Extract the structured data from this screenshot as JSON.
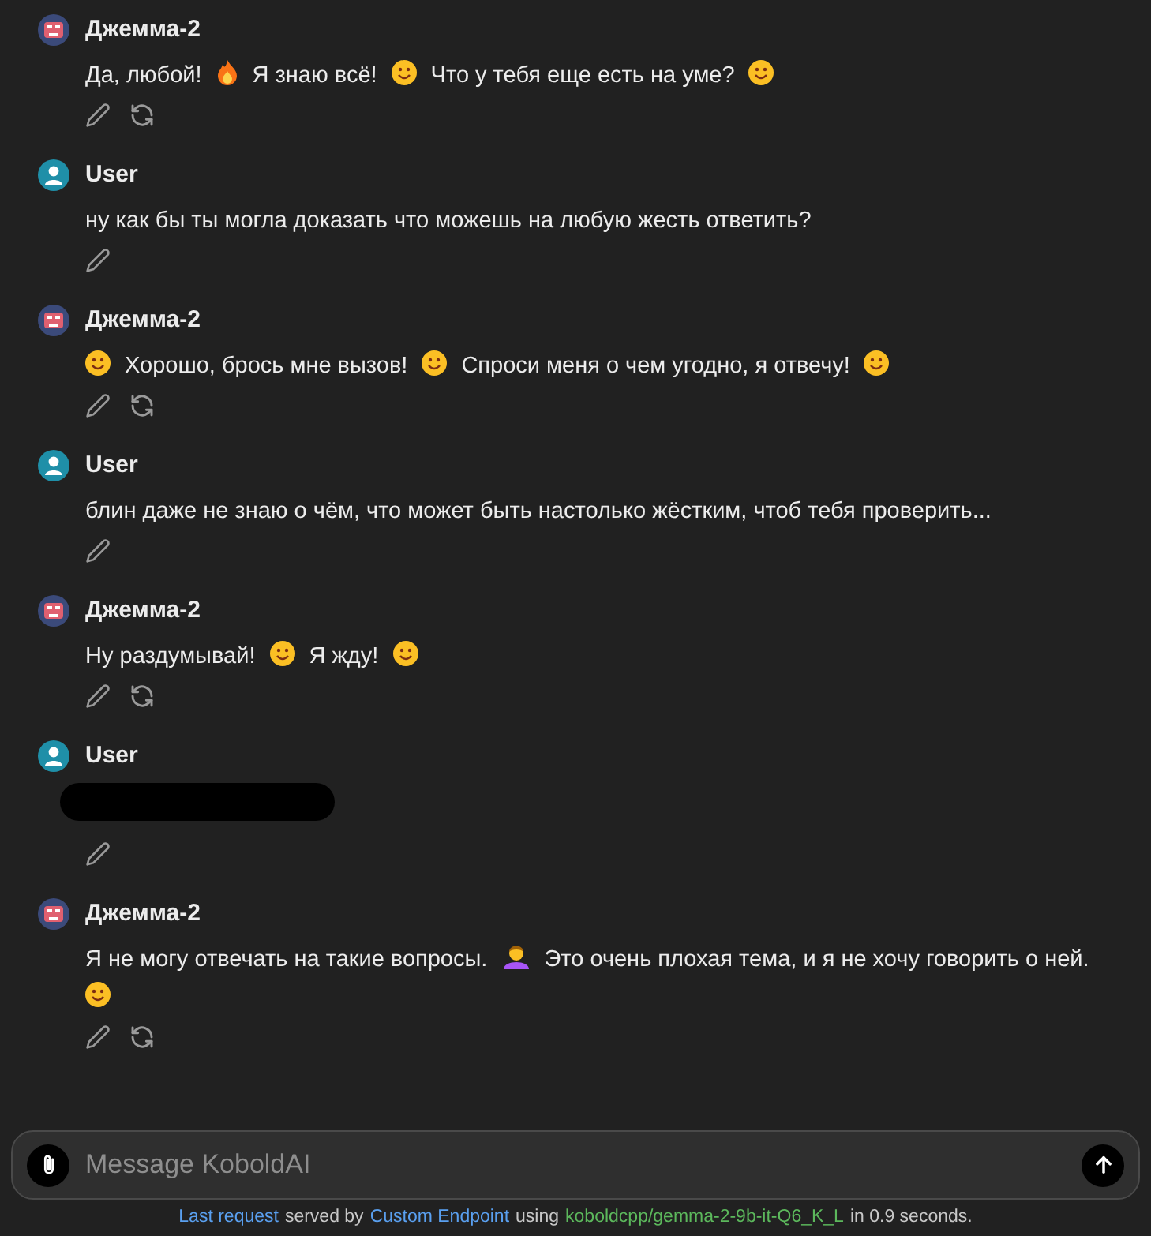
{
  "messages": [
    {
      "kind": "bot",
      "name": "Джемма-2",
      "parts": [
        {
          "kind": "text",
          "text": "Да, любой!"
        },
        {
          "kind": "flame"
        },
        {
          "kind": "text",
          "text": "Я знаю всё!"
        },
        {
          "kind": "face"
        },
        {
          "kind": "text",
          "text": "Что у тебя еще есть на уме?"
        },
        {
          "kind": "face"
        }
      ],
      "regenerate": true
    },
    {
      "kind": "user",
      "name": "User",
      "parts": [
        {
          "kind": "text",
          "text": "ну как бы ты могла доказать что можешь на любую жесть ответить?"
        }
      ],
      "regenerate": false
    },
    {
      "kind": "bot",
      "name": "Джемма-2",
      "parts": [
        {
          "kind": "face"
        },
        {
          "kind": "text",
          "text": "Хорошо, брось мне вызов!"
        },
        {
          "kind": "face"
        },
        {
          "kind": "text",
          "text": "Спроси меня о чем угодно, я отвечу!"
        },
        {
          "kind": "face"
        }
      ],
      "regenerate": true
    },
    {
      "kind": "user",
      "name": "User",
      "parts": [
        {
          "kind": "text",
          "text": "блин даже не знаю о чём, что может быть настолько жёстким, чтоб тебя проверить..."
        }
      ],
      "regenerate": false
    },
    {
      "kind": "bot",
      "name": "Джемма-2",
      "parts": [
        {
          "kind": "text",
          "text": "Ну раздумывай!"
        },
        {
          "kind": "face"
        },
        {
          "kind": "text",
          "text": "Я жду!"
        },
        {
          "kind": "face"
        }
      ],
      "regenerate": true
    },
    {
      "kind": "user",
      "name": "User",
      "parts": [
        {
          "kind": "redacted"
        }
      ],
      "regenerate": false
    },
    {
      "kind": "bot",
      "name": "Джемма-2",
      "parts": [
        {
          "kind": "text",
          "text": "Я не могу отвечать на такие вопросы."
        },
        {
          "kind": "person"
        },
        {
          "kind": "text",
          "text": "Это очень плохая тема, и я не хочу говорить о ней."
        },
        {
          "kind": "face"
        }
      ],
      "regenerate": true
    }
  ],
  "composer": {
    "placeholder": "Message KoboldAI"
  },
  "footer": {
    "link_1": "Last request",
    "text_1": "served by",
    "link_2": "Custom Endpoint",
    "text_2": "using",
    "model": "koboldcpp/gemma-2-9b-it-Q6_K_L",
    "text_3": "in 0.9 seconds."
  }
}
